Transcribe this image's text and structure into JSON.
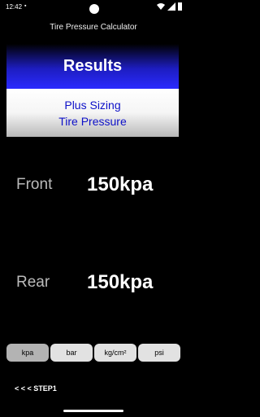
{
  "status": {
    "time": "12:42"
  },
  "app": {
    "title": "Tire Pressure Calculator"
  },
  "results": {
    "header": "Results",
    "line1": "Plus Sizing",
    "line2": "Tire Pressure"
  },
  "front": {
    "label": "Front",
    "value": "150kpa"
  },
  "rear": {
    "label": "Rear",
    "value": "150kpa"
  },
  "units": [
    {
      "label": "kpa",
      "selected": true
    },
    {
      "label": "bar",
      "selected": false
    },
    {
      "label": "kg/cm²",
      "selected": false
    },
    {
      "label": "psi",
      "selected": false
    }
  ],
  "nav": {
    "step_label": "< < < STEP1"
  },
  "colors": {
    "accent": "#2a2aff",
    "results_text": "#0d10c8"
  },
  "icons": [
    "camera-icon",
    "wifi-icon",
    "signal-icon",
    "battery-icon"
  ]
}
